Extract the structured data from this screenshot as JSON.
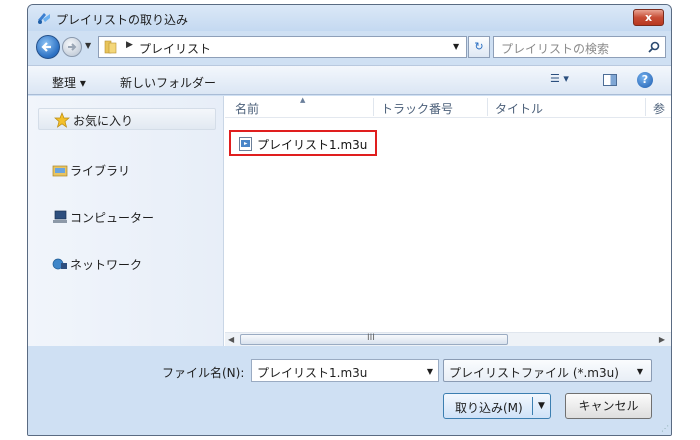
{
  "window": {
    "title": "プレイリストの取り込み",
    "close_label": "x"
  },
  "nav": {
    "path": "プレイリスト",
    "search_placeholder": "プレイリストの検索",
    "refresh_glyph": "↻"
  },
  "toolbar": {
    "organize": "整理 ▾",
    "new_folder": "新しいフォルダー",
    "views_glyph": "☰ ▾",
    "help_glyph": "?"
  },
  "sidebar": {
    "items": [
      {
        "label": "お気に入り",
        "icon": "star-icon"
      },
      {
        "label": "ライブラリ",
        "icon": "library-icon"
      },
      {
        "label": "コンピューター",
        "icon": "computer-icon"
      },
      {
        "label": "ネットワーク",
        "icon": "network-icon"
      }
    ]
  },
  "filelist": {
    "columns": [
      "名前",
      "トラック番号",
      "タイトル",
      "参"
    ],
    "files": [
      {
        "name": "プレイリスト1.m3u",
        "icon": "playlist-file-icon"
      }
    ],
    "scroll_grip": "III"
  },
  "footer": {
    "filename_label": "ファイル名(N):",
    "filename_value": "プレイリスト1.m3u",
    "filetype_value": "プレイリストファイル (*.m3u)",
    "open_label": "取り込み(M)",
    "cancel_label": "キャンセル"
  },
  "colors": {
    "accent": "#2a6fc2",
    "highlight_border": "#e01e1e",
    "frame": "#cfe0f3"
  }
}
